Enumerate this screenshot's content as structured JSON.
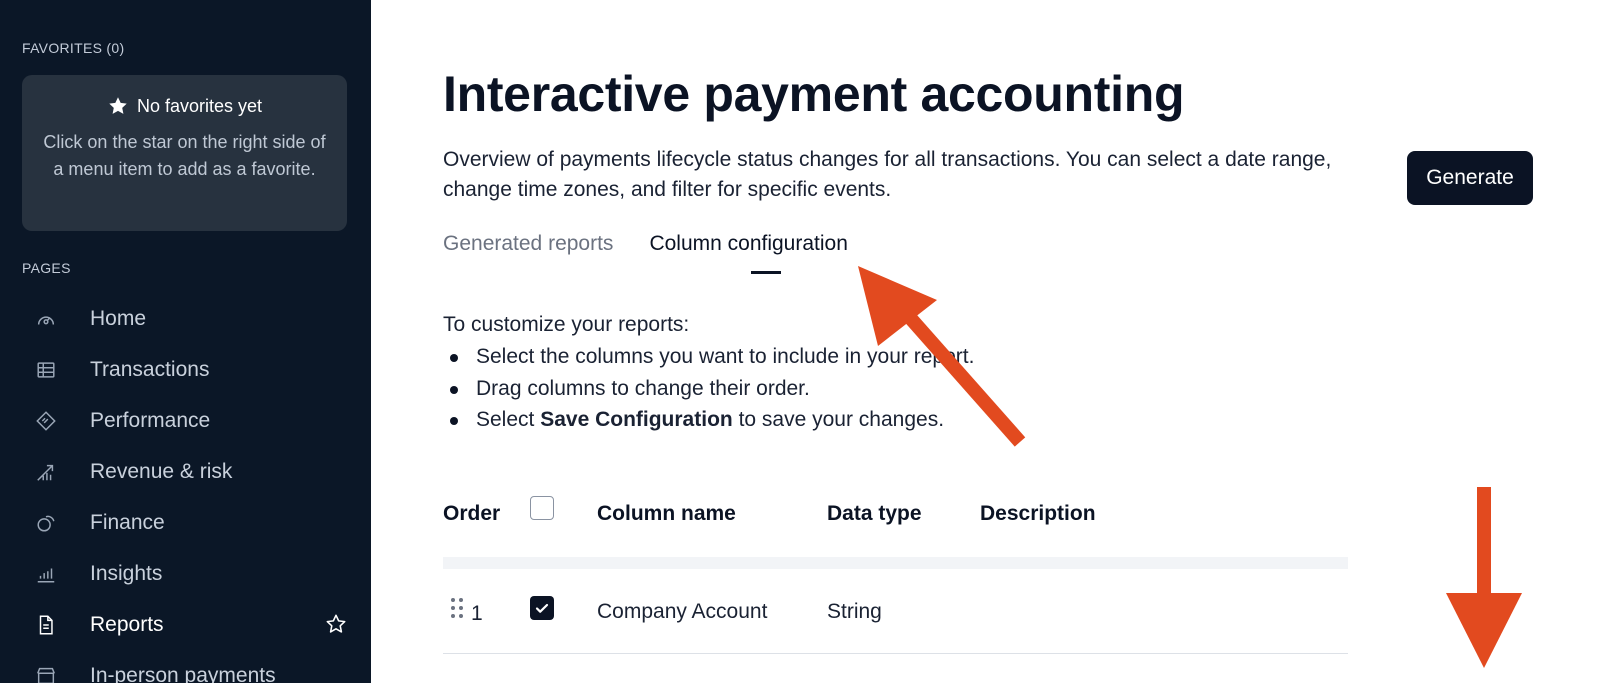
{
  "sidebar": {
    "favorites_label": "FAVORITES (0)",
    "favorites_empty_title": "No favorites yet",
    "favorites_empty_text": "Click on the star on the right side of a menu item to add as a favorite.",
    "pages_label": "PAGES",
    "items": [
      {
        "label": "Home",
        "icon": "home-gauge-icon"
      },
      {
        "label": "Transactions",
        "icon": "table-icon"
      },
      {
        "label": "Performance",
        "icon": "diamond-arrows-icon"
      },
      {
        "label": "Revenue & risk",
        "icon": "trend-arrows-icon"
      },
      {
        "label": "Finance",
        "icon": "coins-icon"
      },
      {
        "label": "Insights",
        "icon": "bar-chart-icon"
      },
      {
        "label": "Reports",
        "icon": "document-icon",
        "active": true
      },
      {
        "label": "In-person payments",
        "icon": "store-icon"
      }
    ]
  },
  "main": {
    "title": "Interactive payment accounting",
    "description": "Overview of payments lifecycle status changes for all transactions. You can select a date range, change time zones, and filter for specific events.",
    "generate_label": "Generate",
    "tabs": [
      {
        "label": "Generated reports",
        "active": false
      },
      {
        "label": "Column configuration",
        "active": true
      }
    ],
    "instructions": {
      "intro": "To customize your reports:",
      "step1": "Select the columns you want to include in your report.",
      "step2": "Drag columns to change their order.",
      "step3_prefix": "Select ",
      "step3_bold": "Save Configuration",
      "step3_suffix": " to save your changes."
    },
    "table": {
      "headers": {
        "order": "Order",
        "column_name": "Column name",
        "data_type": "Data type",
        "description": "Description"
      },
      "rows": [
        {
          "order": "1",
          "checked": true,
          "column_name": "Company Account",
          "data_type": "String",
          "description": ""
        }
      ]
    }
  },
  "colors": {
    "sidebar_bg": "#0b1727",
    "primary": "#0b1324",
    "annotation_arrow": "#e24a1f"
  }
}
